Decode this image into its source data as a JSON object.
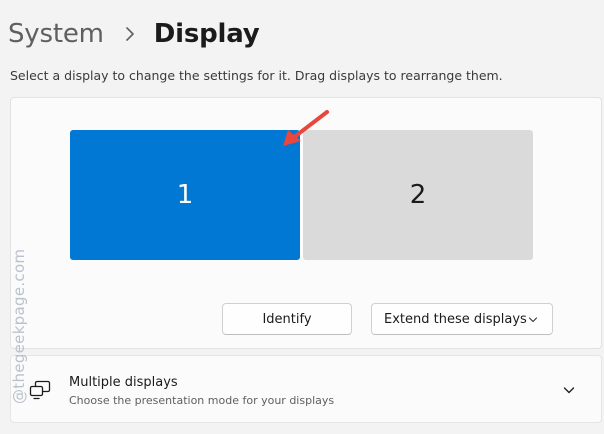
{
  "breadcrumb": {
    "parent": "System",
    "current": "Display"
  },
  "instructions": "Select a display to change the settings for it. Drag displays to rearrange them.",
  "displays": [
    {
      "label": "1",
      "selected": true,
      "color": "#0078d4"
    },
    {
      "label": "2",
      "selected": false,
      "color": "#dadada"
    }
  ],
  "buttons": {
    "identify": "Identify",
    "extend_mode": "Extend these displays"
  },
  "multiple_displays": {
    "title": "Multiple displays",
    "description": "Choose the presentation mode for your displays"
  },
  "icons": {
    "breadcrumb_separator": "chevron-right-icon",
    "mode_dropdown": "chevron-down-icon",
    "card": "multiple-displays-icon",
    "card_expand": "chevron-down-icon",
    "annotation": "red-arrow-icon"
  },
  "watermark": "@thegeekpage.com",
  "colors": {
    "accent": "#0078d4",
    "annotation_arrow": "#e8473f"
  }
}
